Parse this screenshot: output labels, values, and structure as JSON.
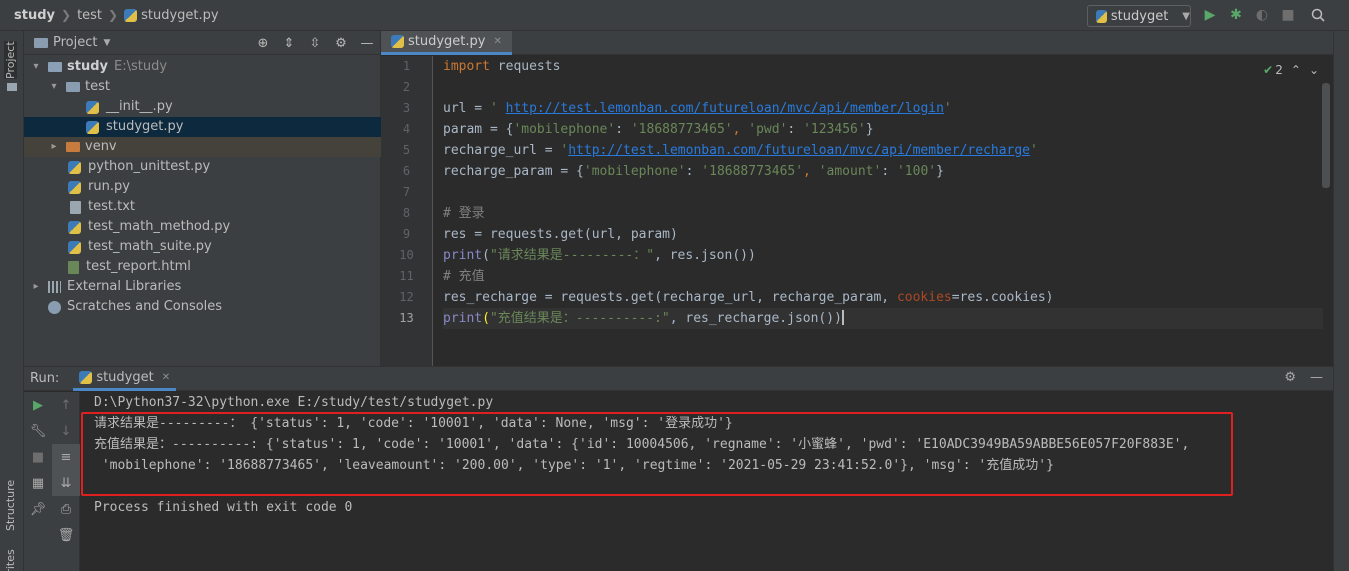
{
  "breadcrumb": {
    "root": "study",
    "folder": "test",
    "file": "studyget.py"
  },
  "toolbar": {
    "run_config": "studyget"
  },
  "left_strip": {
    "project_label": "Project",
    "structure_label": "Structure",
    "favorites_label": "Favorites"
  },
  "project_panel": {
    "title": "Project",
    "tree": [
      {
        "name": "study",
        "detail": "E:\\study"
      },
      {
        "name": "test"
      },
      {
        "name": "__init__.py"
      },
      {
        "name": "studyget.py"
      },
      {
        "name": "venv"
      },
      {
        "name": "python_unittest.py"
      },
      {
        "name": "run.py"
      },
      {
        "name": "test.txt"
      },
      {
        "name": "test_math_method.py"
      },
      {
        "name": "test_math_suite.py"
      },
      {
        "name": "test_report.html"
      },
      {
        "name": "External Libraries"
      },
      {
        "name": "Scratches and Consoles"
      }
    ]
  },
  "editor": {
    "tab": "studyget.py",
    "inspection_count": "2",
    "line_numbers": [
      "1",
      "2",
      "3",
      "4",
      "5",
      "6",
      "7",
      "8",
      "9",
      "10",
      "11",
      "12",
      "13"
    ],
    "code": {
      "l1_kw": "import",
      "l1_rest": " requests",
      "l3_a": "url = ",
      "l3_q1": "' ",
      "l3_url": "http://test.lemonban.com/futureloan/mvc/api/member/login",
      "l3_q2": "'",
      "l4_a": "param = {",
      "l4_s1": "'mobilephone'",
      "l4_b": ": ",
      "l4_s2": "'18688773465'",
      "l4_c": ", ",
      "l4_s3": "'pwd'",
      "l4_d": ": ",
      "l4_s4": "'123456'",
      "l4_e": "}",
      "l5_a": "recharge_url = ",
      "l5_q1": "'",
      "l5_url": "http://test.lemonban.com/futureloan/mvc/api/member/recharge",
      "l5_q2": "'",
      "l6_a": "recharge_param = {",
      "l6_s1": "'mobilephone'",
      "l6_b": ": ",
      "l6_s2": "'18688773465'",
      "l6_c": ", ",
      "l6_s3": "'amount'",
      "l6_d": ": ",
      "l6_s4": "'100'",
      "l6_e": "}",
      "l8_comment": "# 登录",
      "l9": "res = requests.get(url, param)",
      "l10_fn": "print",
      "l10_a": "(",
      "l10_s": "\"请求结果是---------：\"",
      "l10_b": ", res.json())",
      "l11_comment": "# 充值",
      "l12_a": "res_recharge = requests.get(recharge_url, recharge_param, ",
      "l12_kw": "cookies",
      "l12_b": "=res.cookies)",
      "l13_fn": "print",
      "l13_a": "(",
      "l13_s": "\"充值结果是：----------:\"",
      "l13_b": ", res_recharge.json())"
    }
  },
  "run_panel": {
    "label": "Run:",
    "tab": "studyget",
    "output": [
      "D:\\Python37-32\\python.exe E:/study/test/studyget.py",
      "请求结果是---------： {'status': 1, 'code': '10001', 'data': None, 'msg': '登录成功'}",
      "充值结果是：----------: {'status': 1, 'code': '10001', 'data': {'id': 10004506, 'regname': '小蜜蜂', 'pwd': 'E10ADC3949BA59ABBE56E057F20F883E',",
      " 'mobilephone': '18688773465', 'leaveamount': '200.00', 'type': '1', 'regtime': '2021-05-29 23:41:52.0'}, 'msg': '充值成功'}",
      "",
      "Process finished with exit code 0"
    ]
  },
  "colors": {
    "highlight_box": "#e02020",
    "accent": "#4a88c7"
  }
}
